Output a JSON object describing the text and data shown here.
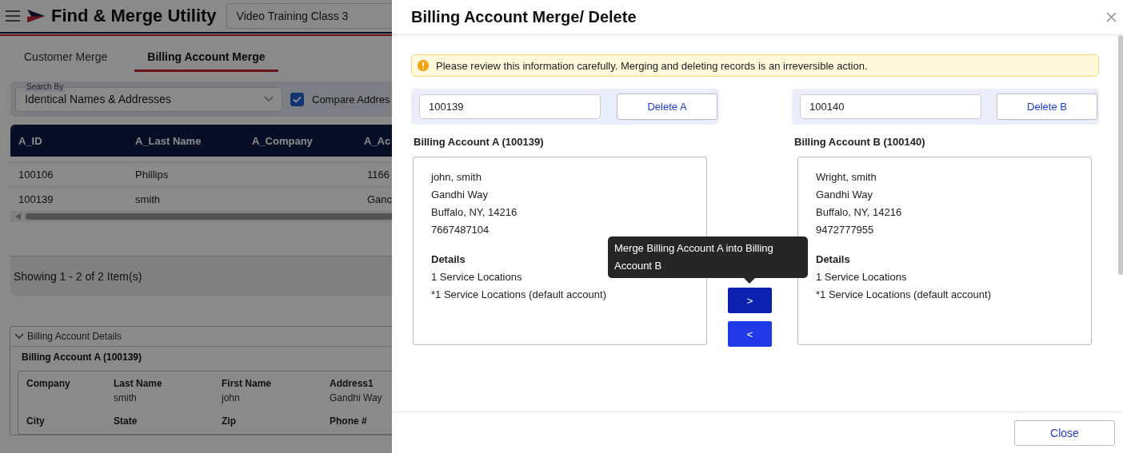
{
  "app": {
    "title": "Find & Merge Utility",
    "class_field": {
      "value": "Video Training Class 3"
    }
  },
  "tabs": [
    {
      "label": "Customer Merge",
      "selected": false
    },
    {
      "label": "Billing Account Merge",
      "selected": true
    }
  ],
  "search": {
    "label": "Search By",
    "value": "Identical Names & Addresses",
    "compare": {
      "label": "Compare Addres",
      "checked": true
    }
  },
  "table": {
    "columns": [
      "A_ID",
      "A_Last Name",
      "A_Company",
      "A_Ac"
    ],
    "rows": [
      {
        "cells": [
          "100106",
          "Phillips",
          null,
          "1166"
        ]
      },
      {
        "cells": [
          "100139",
          "smith",
          null,
          "Ganc"
        ]
      }
    ]
  },
  "pager": {
    "text": "Showing 1 - 2 of 2 Item(s)"
  },
  "details": {
    "title": "Billing Account Details",
    "expanded": true,
    "account_title": "Billing Account A (100139)",
    "fields": [
      {
        "label": "Company"
      },
      {
        "label": "Last Name",
        "value": "smith"
      },
      {
        "label": "First Name",
        "value": "john"
      },
      {
        "label": "Address1",
        "value": "Gandhi Way"
      },
      {
        "label": "City"
      },
      {
        "label": "State"
      },
      {
        "label": "Zip"
      },
      {
        "label": "Phone #"
      }
    ]
  },
  "modal": {
    "title": "Billing Account Merge/ Delete",
    "alert": "Please review this information carefully. Merging and deleting records is an irreversible action.",
    "accounts": [
      {
        "id_value": "100139",
        "delete_label": "Delete A",
        "heading": "Billing Account A (100139)",
        "lines": [
          "john, smith",
          "Gandhi Way",
          "Buffalo, NY, 14216",
          "7667487104"
        ],
        "details_heading": "Details",
        "details": [
          "1 Service Locations",
          "*1 Service Locations (default account)"
        ]
      },
      {
        "id_value": "100140",
        "delete_label": "Delete B",
        "heading": "Billing Account B (100140)",
        "lines": [
          "Wright, smith",
          "Gandhi Way",
          "Buffalo, NY, 14216",
          "9472777955"
        ],
        "details_heading": "Details",
        "details": [
          "1 Service Locations",
          "*1 Service Locations (default account)"
        ]
      }
    ],
    "merge_buttons": [
      {
        "label": ">",
        "hovered": true
      },
      {
        "label": "<",
        "hovered": false
      }
    ],
    "tooltip": "Merge Billing Account A into Billing Account B",
    "close_button": "Close"
  }
}
